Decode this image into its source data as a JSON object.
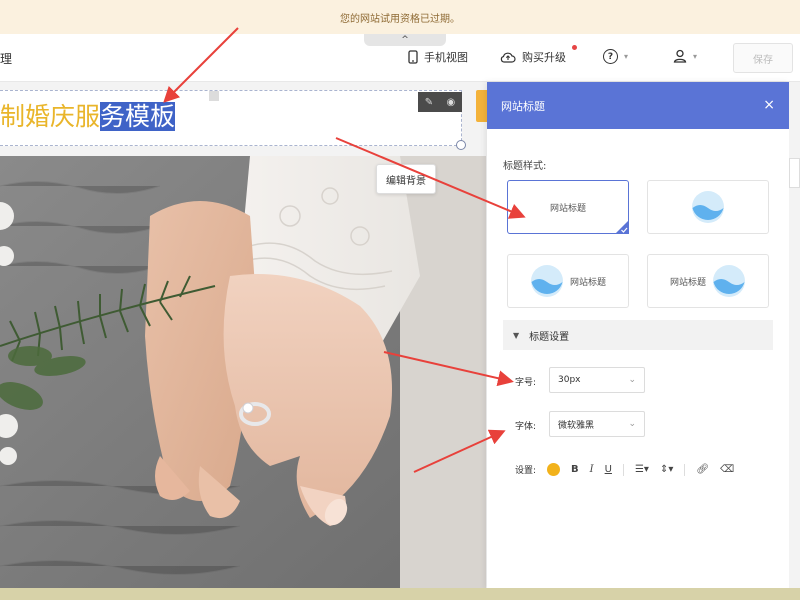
{
  "notice": {
    "text": "您的网站试用资格已过期。"
  },
  "collapse": {
    "glyph": "^"
  },
  "toolbar": {
    "left_fragment": "理",
    "mobile_view": "手机视图",
    "upgrade": "购买升级",
    "help_glyph": "?",
    "save": "保存"
  },
  "editor": {
    "title_part_a": "制婚庆服",
    "title_part_b": "务模板",
    "edit_background": "编辑背景"
  },
  "panel": {
    "header": "网站标题",
    "close_glyph": "×",
    "styles_label": "标题样式:",
    "style_cards": [
      {
        "label": "网站标题"
      },
      {
        "label": ""
      },
      {
        "label": "网站标题"
      },
      {
        "label": "网站标题"
      }
    ],
    "settings_title": "标题设置",
    "font_size_label": "字号:",
    "font_size_value": "30px",
    "font_family_label": "字体:",
    "font_family_value": "微软雅黑",
    "format_label": "设置:",
    "format_bold": "B",
    "format_italic": "I",
    "format_underline": "U",
    "accent_color": "#f2b21b"
  },
  "colors": {
    "panel_header": "#5a74d6",
    "title_yellow": "#e9b52a",
    "selection": "#3f63c7",
    "notice_bg": "#fbf1df"
  }
}
